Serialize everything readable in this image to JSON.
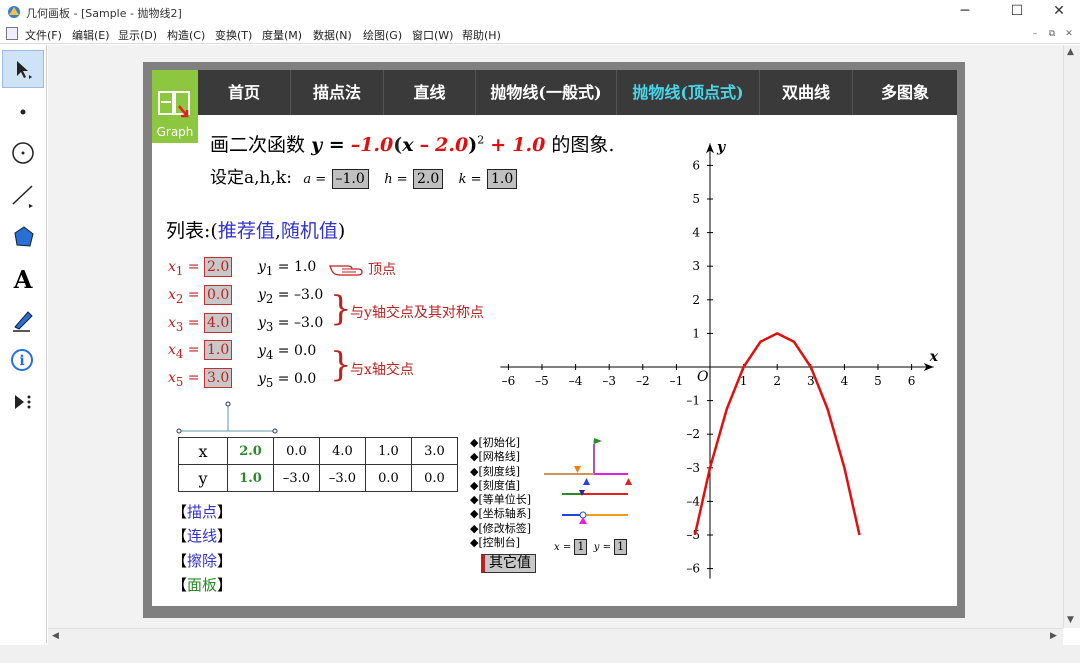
{
  "window": {
    "title": "几何画板 - [Sample - 抛物线2]",
    "minimize": "─",
    "maximize": "☐",
    "close": "✕"
  },
  "menu": [
    "文件(F)",
    "编辑(E)",
    "显示(D)",
    "构造(C)",
    "变换(T)",
    "度量(M)",
    "数据(N)",
    "绘图(G)",
    "窗口(W)",
    "帮助(H)"
  ],
  "mdi": {
    "minimize": "–",
    "restore": "⧉",
    "close": "✕"
  },
  "tools": [
    "arrow-tool",
    "point-tool",
    "compass-tool",
    "straightedge-tool",
    "polygon-tool",
    "text-tool",
    "marker-tool",
    "information-tool",
    "custom-tool"
  ],
  "logo": {
    "text": "Graph",
    "color": "#8dc63f"
  },
  "nav_tabs": [
    "首页",
    "描点法",
    "直线",
    "抛物线(一般式)",
    "抛物线(顶点式)",
    "双曲线",
    "多图象"
  ],
  "nav_active_index": 4,
  "problem": {
    "prefix": "画二次函数",
    "formula_y": "y =",
    "formula_a": "–1.0",
    "formula_open": "(",
    "formula_x": "x",
    "formula_minus": "–",
    "formula_h": "2.0",
    "formula_close": ")",
    "formula_exp": "2",
    "formula_plus": "+",
    "formula_k": "1.0",
    "suffix": "的图象."
  },
  "params": {
    "label": "设定a,h,k:",
    "a_label": "a =",
    "a": "–1.0",
    "h_label": "h =",
    "h": "2.0",
    "k_label": "k =",
    "k": "1.0"
  },
  "list_header": {
    "prefix": "列表:(",
    "recommend": "推荐值",
    "sep": ",",
    "random": "随机值",
    "suffix": ")"
  },
  "points": [
    {
      "x_label": "x",
      "sub": "1",
      "x": "2.0",
      "y_label": "y",
      "y": "1.0"
    },
    {
      "x_label": "x",
      "sub": "2",
      "x": "0.0",
      "y_label": "y",
      "y": "–3.0"
    },
    {
      "x_label": "x",
      "sub": "3",
      "x": "4.0",
      "y_label": "y",
      "y": "–3.0"
    },
    {
      "x_label": "x",
      "sub": "4",
      "x": "1.0",
      "y_label": "y",
      "y": "0.0"
    },
    {
      "x_label": "x",
      "sub": "5",
      "x": "3.0",
      "y_label": "y",
      "y": "0.0"
    }
  ],
  "annotations": {
    "vertex": "顶点",
    "y_axis": "与y轴交点及其对称点",
    "x_axis": "与x轴交点"
  },
  "table": {
    "x_header": "x",
    "y_header": "y",
    "x_values": [
      "2.0",
      "0.0",
      "4.0",
      "1.0",
      "3.0"
    ],
    "y_values": [
      "1.0",
      "–3.0",
      "–3.0",
      "0.0",
      "0.0"
    ]
  },
  "actions": [
    {
      "open": "【",
      "label": "描点",
      "close": "】",
      "color": "#3333cc"
    },
    {
      "open": "【",
      "label": "连线",
      "close": "】",
      "color": "#3333cc"
    },
    {
      "open": "【",
      "label": "擦除",
      "close": "】",
      "color": "#3333cc"
    },
    {
      "open": "【",
      "label": "面板",
      "close": "】",
      "color": "#2a8a2a"
    }
  ],
  "controls": [
    "初始化",
    "网格线",
    "刻度线",
    "刻度值",
    "等单位长",
    "坐标轴系",
    "修改标签",
    "控制台"
  ],
  "other_values_button": "其它值",
  "scale": {
    "x_label": "x =",
    "x": "1",
    "y_label": "y =",
    "y": "1"
  },
  "chart_data": {
    "type": "line",
    "title": "",
    "xlabel": "x",
    "ylabel": "y",
    "origin_label": "O",
    "xlim": [
      -6,
      6
    ],
    "ylim": [
      -6,
      6
    ],
    "x_ticks": [
      "–6",
      "–5",
      "–4",
      "–3",
      "–2",
      "–1",
      "1",
      "2",
      "3",
      "4",
      "5",
      "6"
    ],
    "y_ticks": [
      "6",
      "5",
      "4",
      "3",
      "2",
      "1",
      "–1",
      "–2",
      "–3",
      "–4",
      "–5",
      "–6"
    ],
    "series": [
      {
        "curve": "y = -1.0(x - 2.0)^2 + 1.0",
        "color": "#e01010",
        "x": [
          -0.45,
          0,
          0.5,
          1,
          1.5,
          2,
          2.5,
          3,
          3.5,
          4,
          4.45
        ],
        "y": [
          -5.0,
          -3.0,
          -1.25,
          0,
          0.75,
          1,
          0.75,
          0,
          -1.25,
          -3.0,
          -5.0
        ]
      }
    ],
    "grid": false
  }
}
